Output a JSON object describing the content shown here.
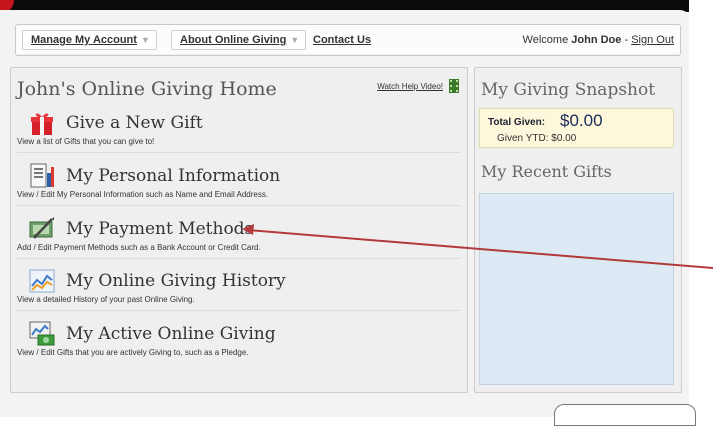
{
  "nav": {
    "manage_account": "Manage My Account",
    "about_giving": "About Online Giving",
    "contact_us": "Contact Us",
    "welcome_prefix": "Welcome",
    "user_name": "John Doe",
    "separator": "-",
    "sign_out": "Sign Out"
  },
  "home": {
    "title": "John's Online Giving Home",
    "help_link": "Watch Help Video!"
  },
  "menu": [
    {
      "title": "Give a New Gift",
      "desc": "View a list of Gifts that you can give to!",
      "icon": "gift-icon"
    },
    {
      "title": "My Personal Information",
      "desc": "View / Edit My Personal Information such as Name and Email Address.",
      "icon": "profile-doc-icon"
    },
    {
      "title": "My Payment Methods",
      "desc": "Add / Edit Payment Methods such as a Bank Account or Credit Card.",
      "icon": "payment-icon"
    },
    {
      "title": "My Online Giving History",
      "desc": "View a detailed History of your past Online Giving.",
      "icon": "chart-history-icon"
    },
    {
      "title": "My Active Online Giving",
      "desc": "View / Edit Gifts that you are actively Giving to, such as a Pledge.",
      "icon": "active-giving-icon"
    }
  ],
  "snapshot": {
    "title": "My Giving Snapshot",
    "total_label": "Total Given:",
    "total_value": "$0.00",
    "ytd_text": "Given YTD: $0.00",
    "recent_title": "My Recent Gifts"
  },
  "colors": {
    "accent_red": "#c4161c",
    "annotation_arrow": "#b33a3a",
    "recent_box": "#dde9f5",
    "snapshot_box": "#fdf8dc"
  }
}
